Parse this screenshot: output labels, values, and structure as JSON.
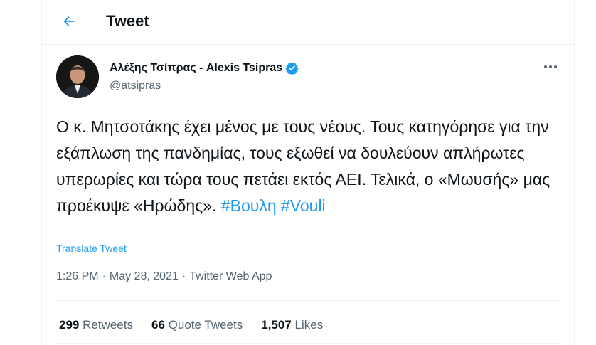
{
  "header": {
    "title": "Tweet"
  },
  "author": {
    "name": "Αλέξης Τσίπρας - Alexis Tsipras",
    "handle": "@atsipras",
    "verified": true
  },
  "tweet": {
    "text": "Ο κ. Μητσοτάκης έχει μένος με τους νέους. Τους κατηγόρησε για την εξάπλωση της πανδημίας, τους εξωθεί να δουλεύουν απλήρωτες υπερωρίες και τώρα τους πετάει εκτός ΑΕΙ. Τελικά, ο «Μωυσής» μας προέκυψε «Ηρώδης».",
    "hashtags": [
      "#Βουλη",
      "#Vouli"
    ],
    "translate_label": "Translate Tweet"
  },
  "meta": {
    "time": "1:26 PM",
    "separator": "·",
    "date": "May 28, 2021",
    "source": "Twitter Web App"
  },
  "stats": {
    "retweets_count": "299",
    "retweets_label": "Retweets",
    "quotes_count": "66",
    "quotes_label": "Quote Tweets",
    "likes_count": "1,507",
    "likes_label": "Likes"
  },
  "colors": {
    "accent": "#1d9bf0",
    "secondary_text": "#536471",
    "border": "#eff3f4"
  }
}
